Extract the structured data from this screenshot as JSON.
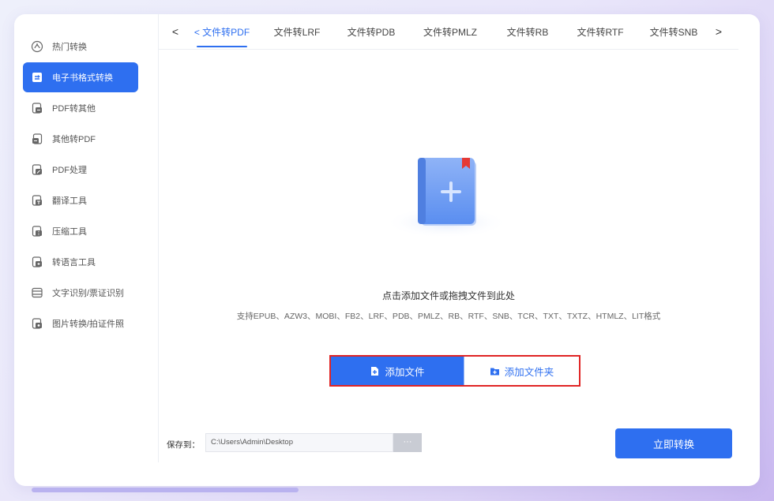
{
  "sidebar": {
    "items": [
      {
        "label": "热门转换",
        "icon": "hot-icon"
      },
      {
        "label": "电子书格式转换",
        "icon": "ebook-icon",
        "active": true
      },
      {
        "label": "PDF转其他",
        "icon": "pdf-export-icon"
      },
      {
        "label": "其他转PDF",
        "icon": "pdf-import-icon"
      },
      {
        "label": "PDF处理",
        "icon": "pdf-edit-icon"
      },
      {
        "label": "翻译工具",
        "icon": "translate-icon"
      },
      {
        "label": "压缩工具",
        "icon": "compress-icon"
      },
      {
        "label": "转语言工具",
        "icon": "voice-icon"
      },
      {
        "label": "文字识别/票证识别",
        "icon": "ocr-icon"
      },
      {
        "label": "图片转换/拍证件照",
        "icon": "image-icon"
      }
    ]
  },
  "tabs": {
    "prev_arrow": "<",
    "next_arrow": ">",
    "items": [
      {
        "label": "< 文件转PDF",
        "active": true
      },
      {
        "label": "文件转LRF"
      },
      {
        "label": "文件转PDB"
      },
      {
        "label": "文件转PMLZ"
      },
      {
        "label": "文件转RB"
      },
      {
        "label": "文件转RTF"
      },
      {
        "label": "文件转SNB"
      }
    ]
  },
  "drop": {
    "title": "点击添加文件或拖拽文件到此处",
    "formats": "支持EPUB、AZW3、MOBI、FB2、LRF、PDB、PMLZ、RB、RTF、SNB、TCR、TXT、TXTZ、HTMLZ、LIT格式",
    "add_file": "添加文件",
    "add_folder": "添加文件夹"
  },
  "footer": {
    "save_label": "保存到：",
    "save_path": "C:\\Users\\Admin\\Desktop",
    "browse": "···",
    "convert": "立即转换"
  },
  "colors": {
    "accent": "#2e6ff0",
    "highlight_border": "#e02424"
  }
}
